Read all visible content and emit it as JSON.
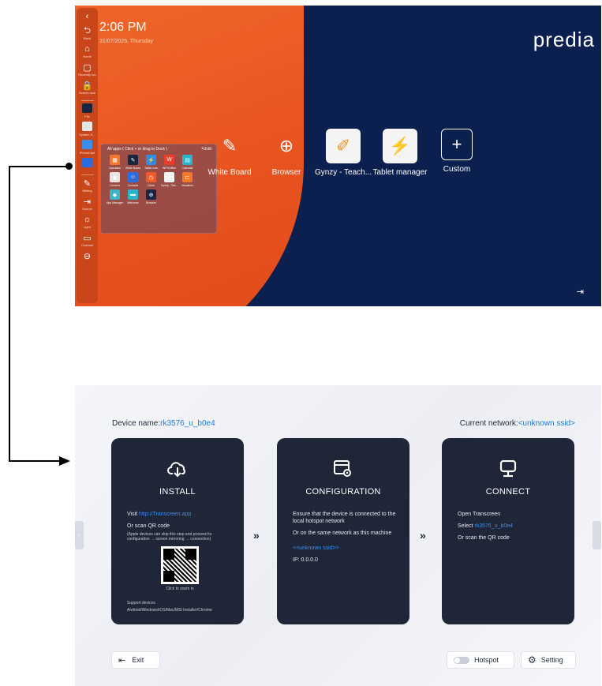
{
  "top": {
    "clock": "2:06 PM",
    "date": "31/07/2025, Thursday",
    "brand": "predia",
    "sidebar": [
      {
        "icon": "chevron-left-icon",
        "glyph": "‹",
        "label": ""
      },
      {
        "icon": "back-icon",
        "glyph": "⮌",
        "label": "Back"
      },
      {
        "icon": "home-icon",
        "glyph": "⌂",
        "label": "Home"
      },
      {
        "icon": "recent-icon",
        "glyph": "▢",
        "label": "Recently run"
      },
      {
        "icon": "lock-icon",
        "glyph": "🔒",
        "label": "Screen lock"
      }
    ],
    "sidebar_lower": [
      {
        "icon": "writing-icon",
        "glyph": "✎",
        "label": "Writing"
      },
      {
        "icon": "source-icon",
        "glyph": "⇥",
        "label": "Source"
      },
      {
        "icon": "light-icon",
        "glyph": "☼",
        "label": "Light"
      },
      {
        "icon": "channel-icon",
        "glyph": "▭",
        "label": "Channel"
      },
      {
        "icon": "more-icon",
        "glyph": "⊖",
        "label": ""
      }
    ],
    "sidebar_apps": [
      {
        "label": "File",
        "color": "#1b2540"
      },
      {
        "label": "System S...",
        "color": "#e8e4e0"
      },
      {
        "label": "iPrimeCast",
        "color": "#3a8ef0"
      },
      {
        "label": "",
        "color": "#2d6be0"
      }
    ],
    "popup": {
      "title": "All apps ( Click + or drag to Dock )",
      "edit": "Edit",
      "apps": [
        {
          "label": "Calculator",
          "color": "#f07a2a",
          "glyph": "▦"
        },
        {
          "label": "White Board",
          "color": "#1b2540",
          "glyph": "✎"
        },
        {
          "label": "Tablet man",
          "color": "#2d8ee8",
          "glyph": "⚡"
        },
        {
          "label": "WPSOffice",
          "color": "#e8402a",
          "glyph": "W"
        },
        {
          "label": "Calendar",
          "color": "#2ab5c8",
          "glyph": "▤"
        },
        {
          "label": "",
          "color": "transparent",
          "glyph": ""
        },
        {
          "label": "Camera",
          "color": "#e8e4e0",
          "glyph": "◉"
        },
        {
          "label": "Contacts",
          "color": "#2d6be0",
          "glyph": "☺"
        },
        {
          "label": "Clock",
          "color": "#f05a2a",
          "glyph": "◷"
        },
        {
          "label": "Gynzy - Tea...",
          "color": "#f2f2f2",
          "glyph": "✐"
        },
        {
          "label": "Visualizer",
          "color": "#f07a2a",
          "glyph": "⊏"
        },
        {
          "label": "",
          "color": "transparent",
          "glyph": ""
        },
        {
          "label": "App Manager",
          "color": "#3ab5c8",
          "glyph": "◆"
        },
        {
          "label": "Welcome",
          "color": "#2ab5c8",
          "glyph": "▬"
        },
        {
          "label": "Browser",
          "color": "#1b2540",
          "glyph": "⊕"
        }
      ]
    },
    "dock": [
      {
        "label": "White Board",
        "icon": "whiteboard-icon",
        "glyph": "✎",
        "bg": "transparent"
      },
      {
        "label": "Browser",
        "icon": "globe-icon",
        "glyph": "⊕",
        "bg": "transparent"
      },
      {
        "label": "Gynzy - Teach...",
        "icon": "gynzy-icon",
        "glyph": "✐",
        "bg": "#f4f4f4"
      },
      {
        "label": "Tablet manager",
        "icon": "tablet-manager-icon",
        "glyph": "⚡",
        "bg": "#f4f4f4"
      },
      {
        "label": "Custom",
        "icon": "plus-icon",
        "glyph": "+",
        "bg": "transparent"
      }
    ]
  },
  "bottom": {
    "device_label": "Device name:",
    "device_value": "rk3576_u_b0e4",
    "network_label": "Current network:",
    "network_value": "<unknown ssid>",
    "install": {
      "title": "INSTALL",
      "visit_prefix": "Visit ",
      "visit_link": "http://Transcreen.app",
      "scan": "Or scan QR code",
      "apple_note": "(Apple devices can skip this step and proceed to configuration → screen mirroring → connection)",
      "qr_caption": "Click to zoom in",
      "support_title": "Support devices",
      "support_list": "Android/Windows/iOS/Mac/MSI Installer/Chrome"
    },
    "config": {
      "title": "CONFIGURATION",
      "line1": "Ensure that the device is connected to the local hotspot network",
      "line2": "Or on the same network as this machine",
      "ssid": "<<unknown ssid>>",
      "ip": "IP: 0.0.0.0"
    },
    "connect": {
      "title": "CONNECT",
      "line1": "Open Transcreen",
      "select_prefix": "Select ",
      "select_value": "rk3576_u_b0e4",
      "line3": "Or scan the QR code"
    },
    "chevron": "»",
    "exit_label": "Exit",
    "hotspot_label": "Hotspot",
    "setting_label": "Setting"
  }
}
